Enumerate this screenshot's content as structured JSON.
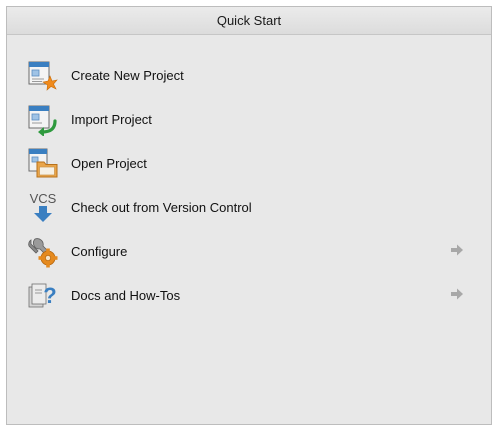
{
  "panel": {
    "title": "Quick Start"
  },
  "items": [
    {
      "label": "Create New Project",
      "icon": "create-project-icon",
      "has_arrow": false
    },
    {
      "label": "Import Project",
      "icon": "import-project-icon",
      "has_arrow": false
    },
    {
      "label": "Open Project",
      "icon": "open-project-icon",
      "has_arrow": false
    },
    {
      "label": "Check out from Version Control",
      "icon": "vcs-checkout-icon",
      "icon_text": "VCS",
      "has_arrow": false
    },
    {
      "label": "Configure",
      "icon": "wrench-gear-icon",
      "has_arrow": true
    },
    {
      "label": "Docs and How-Tos",
      "icon": "docs-help-icon",
      "has_arrow": true
    }
  ],
  "colors": {
    "panel_bg": "#e8e8e8",
    "header_bg": "#dcdcdc",
    "icon_blue": "#3a7fc1",
    "icon_green": "#2e9a3e",
    "icon_orange": "#e58a1f",
    "arrow_gray": "#a8a8a8"
  }
}
